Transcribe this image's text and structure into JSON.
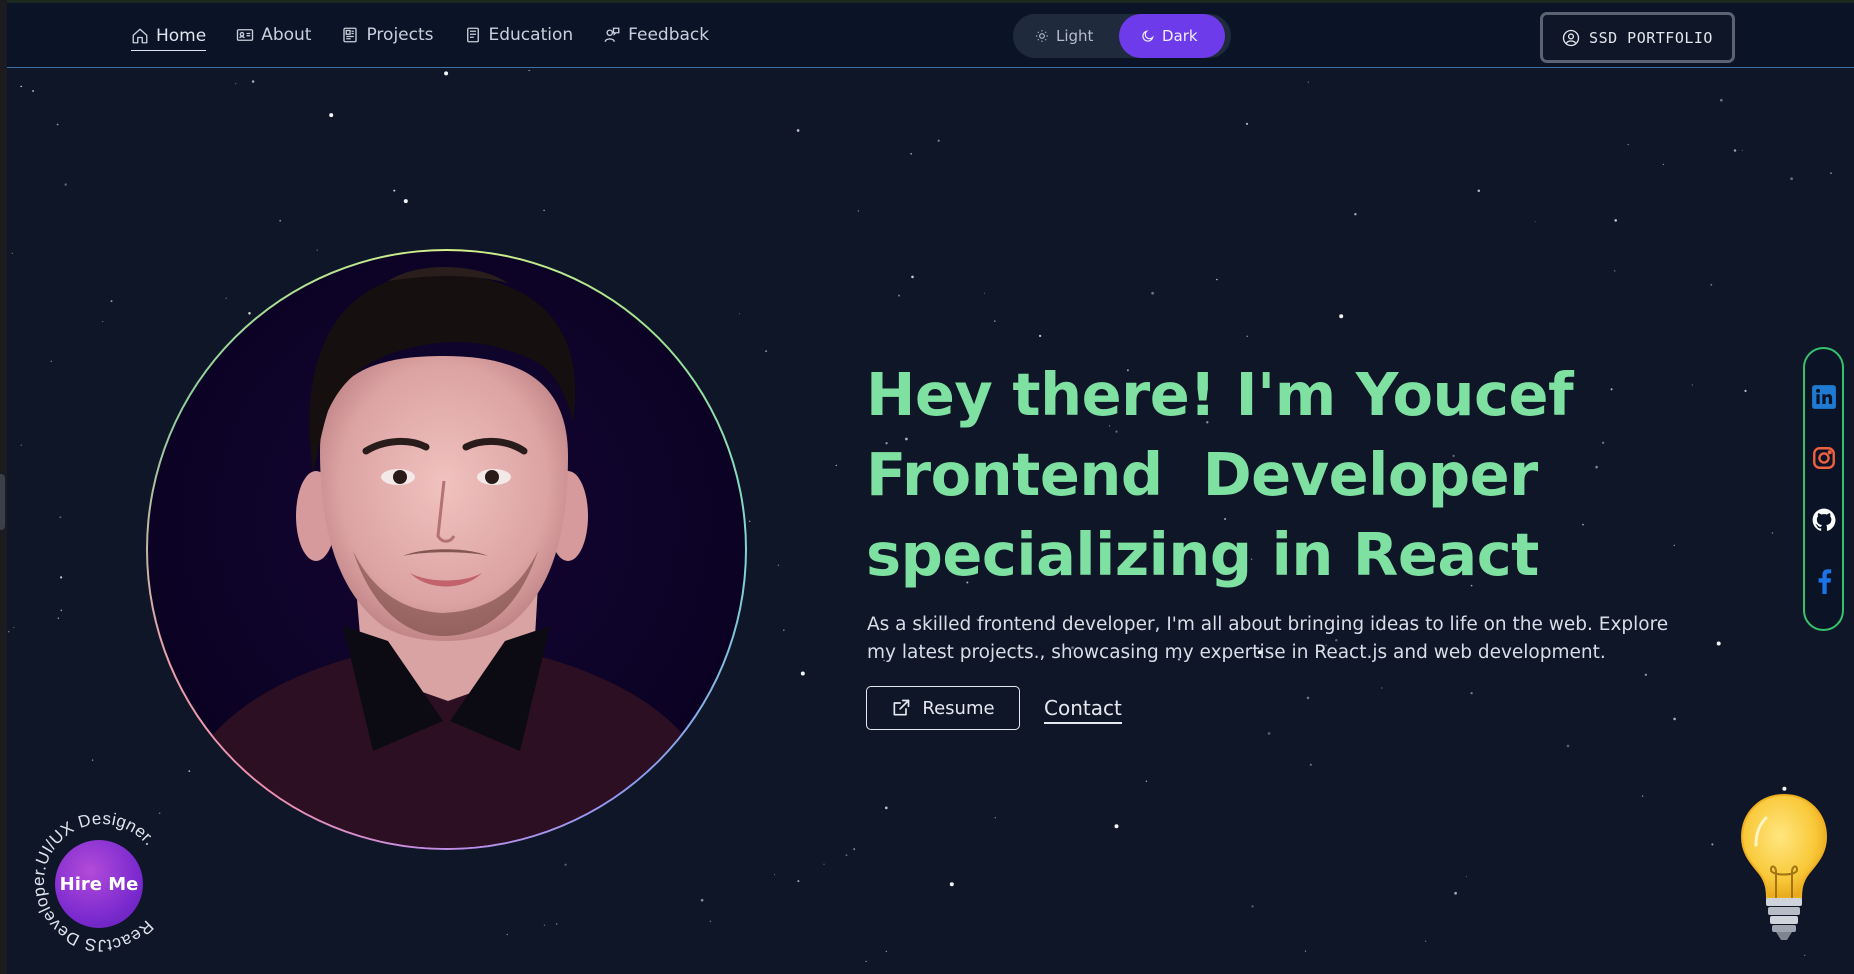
{
  "nav": {
    "items": [
      {
        "label": "Home",
        "icon": "home-icon",
        "active": true
      },
      {
        "label": "About",
        "icon": "id-card-icon"
      },
      {
        "label": "Projects",
        "icon": "projects-icon"
      },
      {
        "label": "Education",
        "icon": "book-icon"
      },
      {
        "label": "Feedback",
        "icon": "feedback-icon"
      }
    ],
    "theme": {
      "light_label": "Light",
      "dark_label": "Dark",
      "selected": "Dark"
    },
    "badge_label": "SSD PORTFOLIO"
  },
  "hero": {
    "title_lines": [
      "Hey there! I'm Youcef",
      "Frontend  Developer",
      "specializing in React"
    ],
    "description": "As a skilled frontend developer, I'm all about bringing ideas to life on the web. Explore my latest projects., showcasing my expertise in React.js and web development.",
    "resume_label": "Resume",
    "contact_label": "Contact"
  },
  "social": [
    {
      "name": "LinkedIn",
      "icon": "linkedin-icon"
    },
    {
      "name": "Instagram",
      "icon": "instagram-icon"
    },
    {
      "name": "GitHub",
      "icon": "github-icon"
    },
    {
      "name": "Facebook",
      "icon": "facebook-icon"
    }
  ],
  "hire": {
    "label": "Hire Me",
    "ring_text": "ReactJS Developer.UI/UX Designer."
  },
  "colors": {
    "background": "#0f1628",
    "accent_green": "#7ee0a1",
    "accent_purple": "#6d3bea",
    "social_border": "#35c26a"
  }
}
